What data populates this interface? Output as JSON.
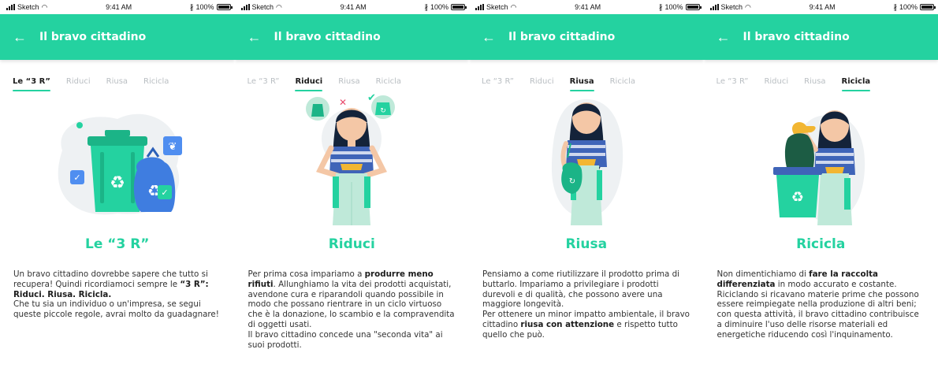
{
  "status_bar": {
    "carrier": "Sketch",
    "time": "9:41 AM",
    "battery": "100%"
  },
  "appbar": {
    "back_icon": "←",
    "title": "Il bravo cittadino"
  },
  "tabs": [
    "Le “3 R”",
    "Riduci",
    "Riusa",
    "Ricicla"
  ],
  "colors": {
    "accent": "#24d2a0",
    "text": "#333333",
    "inactive_tab": "#b9bec2"
  },
  "screens": [
    {
      "active_tab": 0,
      "illustration": "recycling-bins-illustration",
      "heading": "Le “3 R”",
      "paragraphs": [
        [
          {
            "t": "Un bravo cittadino dovrebbe sapere che tutto si recupera! Quindi ricordiamoci sempre le "
          },
          {
            "t": "“3 R”: Riduci. Riusa. Ricicla.",
            "b": true
          }
        ],
        [
          {
            "t": "Che tu sia un individuo o un'impresa, se segui queste piccole regole, avrai molto da guadagnare!"
          }
        ]
      ]
    },
    {
      "active_tab": 1,
      "illustration": "woman-reduce-illustration",
      "heading": "Riduci",
      "paragraphs": [
        [
          {
            "t": "Per prima cosa impariamo a "
          },
          {
            "t": "produrre meno rifiuti",
            "b": true
          },
          {
            "t": ". Allunghiamo la vita dei prodotti acquistati, avendone cura e riparandoli quando possibile in modo che possano rientrare in un ciclo virtuoso che è la donazione, lo scambio e la compravendita di oggetti usati."
          }
        ],
        [
          {
            "t": "Il bravo cittadino concede una \"seconda vita\" ai suoi prodotti."
          }
        ]
      ]
    },
    {
      "active_tab": 2,
      "illustration": "woman-reuse-bag-illustration",
      "heading": "Riusa",
      "paragraphs": [
        [
          {
            "t": "Pensiamo a come riutilizzare il prodotto prima di buttarlo. Impariamo a privilegiare i prodotti durevoli e di qualità, che possono avere una maggiore longevità."
          }
        ],
        [
          {
            "t": "Per ottenere un minor impatto ambientale, il bravo cittadino "
          },
          {
            "t": "riusa con attenzione",
            "b": true
          },
          {
            "t": " e rispetto tutto quello che può."
          }
        ]
      ]
    },
    {
      "active_tab": 3,
      "illustration": "woman-recycle-bin-illustration",
      "heading": "Ricicla",
      "paragraphs": [
        [
          {
            "t": "Non dimentichiamo di "
          },
          {
            "t": "fare la raccolta differenziata",
            "b": true
          },
          {
            "t": " in modo accurato e costante. Riciclando si ricavano materie prime che possono essere reimpiegate nella produzione di altri beni; con questa attività, il bravo cittadino contribuisce a diminuire l'uso delle risorse materiali ed energetiche riducendo così l'inquinamento."
          }
        ]
      ]
    }
  ]
}
